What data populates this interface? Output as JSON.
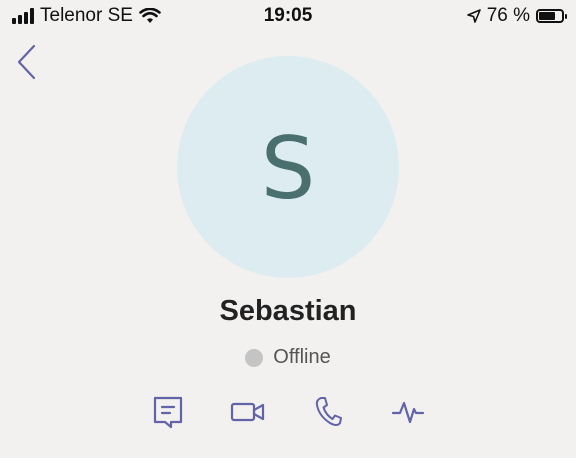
{
  "status_bar": {
    "carrier": "Telenor SE",
    "time": "19:05",
    "battery_percent": "76 %",
    "battery_level": 0.76
  },
  "contact": {
    "avatar_initial": "S",
    "name": "Sebastian",
    "presence": "Offline",
    "presence_color": "#c4c4c4",
    "avatar_bg": "#ddecf0",
    "avatar_fg": "#4a6f6f"
  },
  "theme": {
    "accent": "#6264a7",
    "background": "#f2f1f0"
  },
  "actions": [
    {
      "icon": "chat-icon"
    },
    {
      "icon": "video-icon"
    },
    {
      "icon": "phone-icon"
    },
    {
      "icon": "activity-icon"
    }
  ]
}
